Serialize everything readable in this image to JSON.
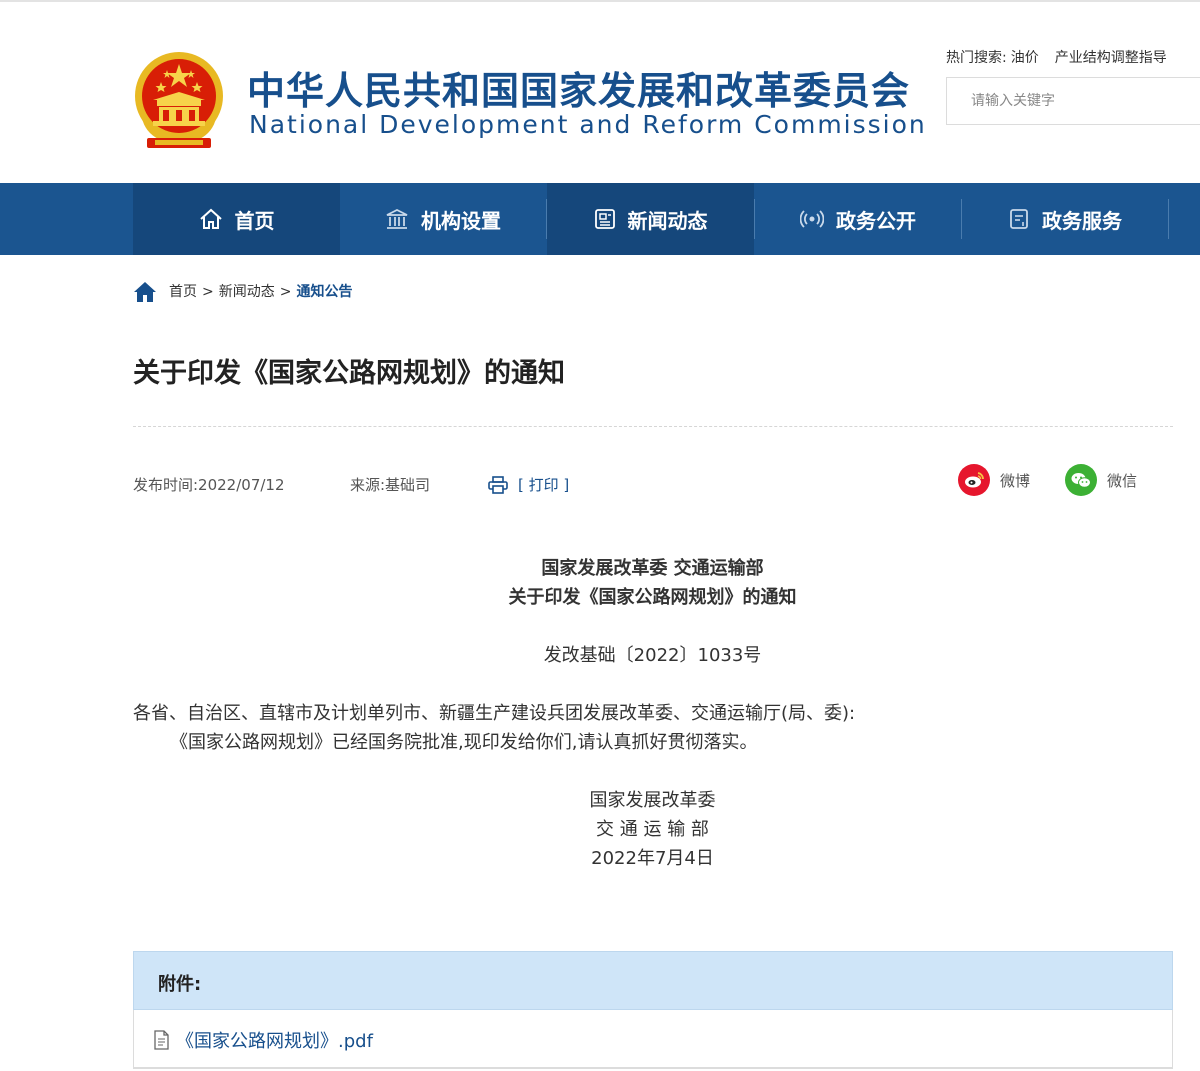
{
  "header": {
    "title_cn": "中华人民共和国国家发展和改革委员会",
    "title_en": "National Development and Reform Commission",
    "hot_search_label": "热门搜索:",
    "hot_search_keywords": [
      "油价",
      "产业结构调整指导"
    ],
    "search_placeholder": "请输入关键字"
  },
  "nav": {
    "items": [
      {
        "label": "首页",
        "icon": "home-icon",
        "active": true
      },
      {
        "label": "机构设置",
        "icon": "building-icon"
      },
      {
        "label": "新闻动态",
        "icon": "newspaper-icon"
      },
      {
        "label": "政务公开",
        "icon": "broadcast-icon"
      },
      {
        "label": "政务服务",
        "icon": "service-icon"
      }
    ]
  },
  "breadcrumb": {
    "items": [
      "首页",
      "新闻动态",
      "通知公告"
    ],
    "separator": ">"
  },
  "article": {
    "title": "关于印发《国家公路网规划》的通知",
    "publish_time": "发布时间:2022/07/12",
    "source": "来源:基础司",
    "print_label": "[ 打印 ]",
    "share": [
      {
        "label": "微博",
        "icon": "weibo-icon",
        "color": "#e6162d"
      },
      {
        "label": "微信",
        "icon": "wechat-icon",
        "color": "#3cb034"
      }
    ],
    "issuer_line": "国家发展改革委 交通运输部",
    "doc_title": "关于印发《国家公路网规划》的通知",
    "doc_number": "发改基础〔2022〕1033号",
    "addressee": "各省、自治区、直辖市及计划单列市、新疆生产建设兵团发展改革委、交通运输厅(局、委):",
    "body": "《国家公路网规划》已经国务院批准,现印发给你们,请认真抓好贯彻落实。",
    "signatures": [
      "国家发展改革委",
      "交 通 运 输 部"
    ],
    "date": "2022年7月4日"
  },
  "attachments": {
    "header": "附件:",
    "files": [
      "《国家公路网规划》.pdf"
    ]
  },
  "colors": {
    "brand_blue": "#174f8c",
    "nav_bg": "#1b5590",
    "nav_active": "#15477b",
    "attachment_header_bg": "#cfe5f8"
  }
}
